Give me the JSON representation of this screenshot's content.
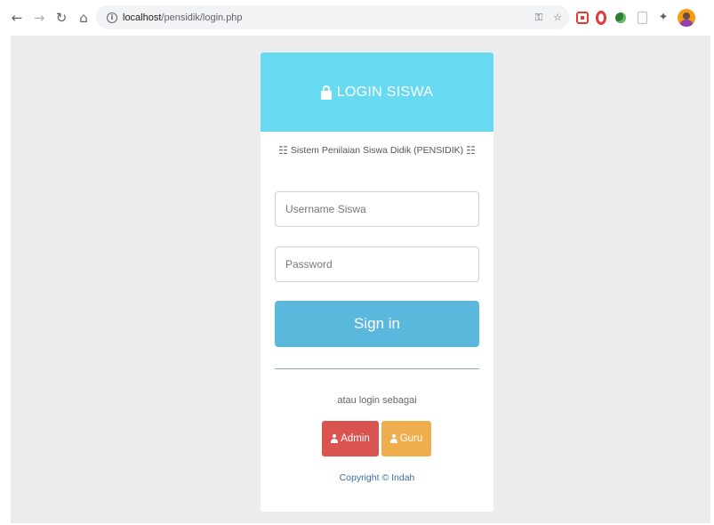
{
  "browser": {
    "back_icon": "←",
    "forward_icon": "→",
    "reload_icon": "↻",
    "home_icon": "⌂",
    "url_host": "localhost",
    "url_path": "/pensidik/login.php",
    "key_icon": "🔑",
    "star_icon": "☆",
    "extensions": [
      "save-extension-icon",
      "opera-extension-icon",
      "green-extension-icon",
      "document-extension-icon",
      "puzzle-extensions-icon",
      "profile-avatar"
    ]
  },
  "login": {
    "header_title": "LOGIN SISWA",
    "header_color": "#67d9f0",
    "subtitle": "Sistem Penilaian Siswa Didik (PENSIDIK)",
    "username_placeholder": "Username Siswa",
    "password_placeholder": "Password",
    "signin_label": "Sign in",
    "signin_color": "#5bb8dd",
    "alt_login_text": "atau login sebagai",
    "admin_label": "Admin",
    "admin_color": "#d9534f",
    "guru_label": "Guru",
    "guru_color": "#f0ad4e",
    "copyright": "Copyright © Indah"
  }
}
